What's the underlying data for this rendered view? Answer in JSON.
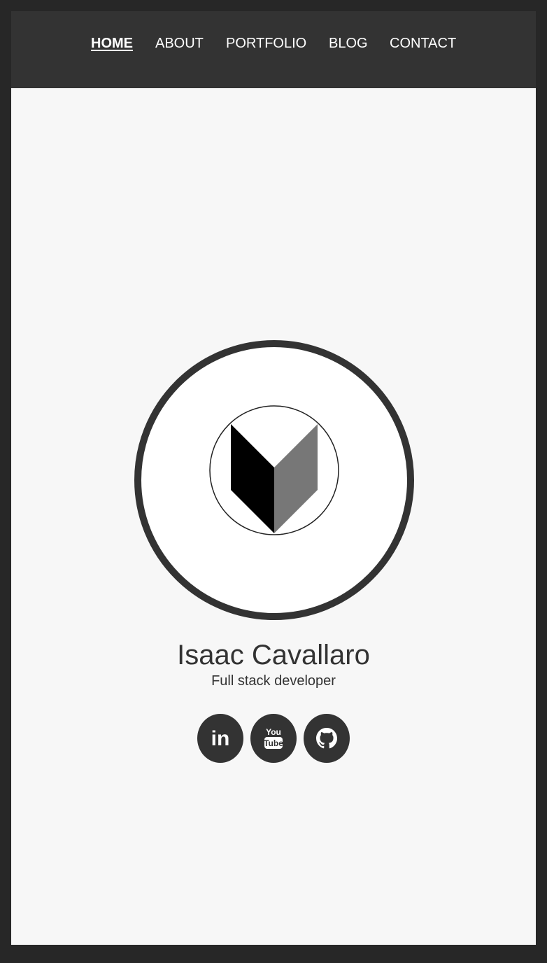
{
  "nav": {
    "items": [
      {
        "label": "HOME",
        "active": true
      },
      {
        "label": "ABOUT",
        "active": false
      },
      {
        "label": "PORTFOLIO",
        "active": false
      },
      {
        "label": "BLOG",
        "active": false
      },
      {
        "label": "CONTACT",
        "active": false
      }
    ]
  },
  "profile": {
    "name": "Isaac Cavallaro",
    "subtitle": "Full stack developer"
  },
  "social": {
    "linkedin": {
      "icon": "linkedin-icon",
      "text": "in"
    },
    "youtube": {
      "icon": "youtube-icon",
      "text_top": "You",
      "text_bottom": "Tube"
    },
    "github": {
      "icon": "github-icon"
    }
  },
  "colors": {
    "page_border": "#272727",
    "navbar": "#333333",
    "content_bg": "#f7f7f7",
    "text": "#333333",
    "nav_text": "#ffffff"
  }
}
